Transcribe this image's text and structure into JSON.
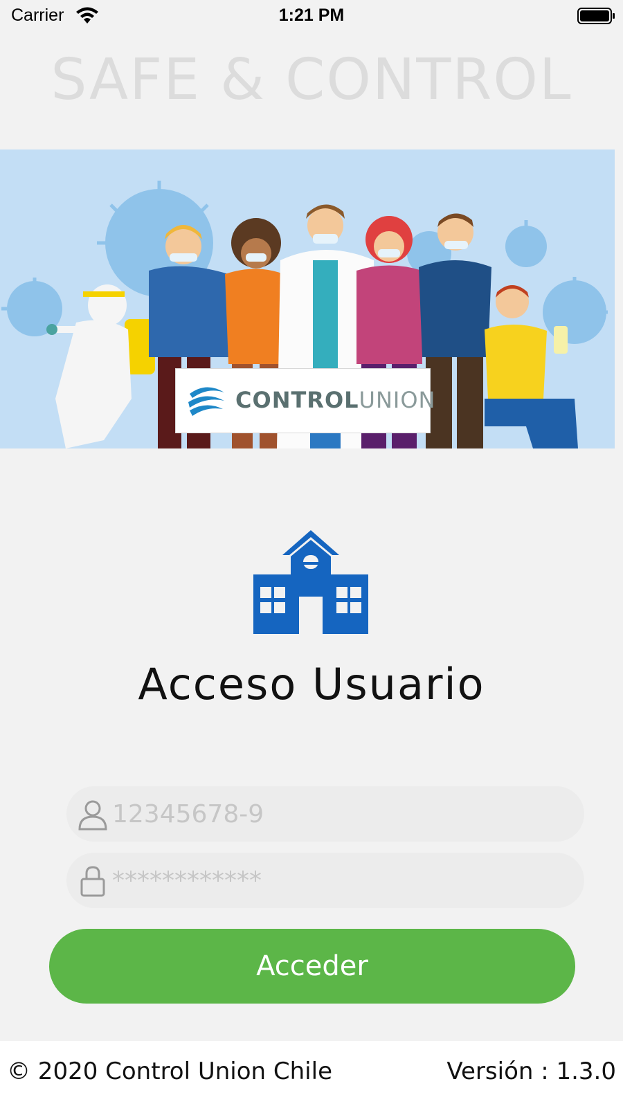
{
  "status_bar": {
    "carrier": "Carrier",
    "time": "1:21 PM"
  },
  "app": {
    "title": "SAFE & CONTROL"
  },
  "banner": {
    "brand_bold": "CONTROL",
    "brand_light": "UNION",
    "background_color": "#c3def5"
  },
  "login": {
    "heading": "Acceso Usuario",
    "username_placeholder": "12345678-9",
    "password_placeholder": "************",
    "submit_label": "Acceder"
  },
  "footer": {
    "copyright": "© 2020 Control Union Chile",
    "version": "Versión : 1.3.0"
  },
  "colors": {
    "accent_blue": "#1565c0",
    "button_green": "#5cb648",
    "page_background": "#f2f2f2"
  },
  "icons": {
    "school": "school-building-icon",
    "user": "user-icon",
    "lock": "lock-icon"
  }
}
